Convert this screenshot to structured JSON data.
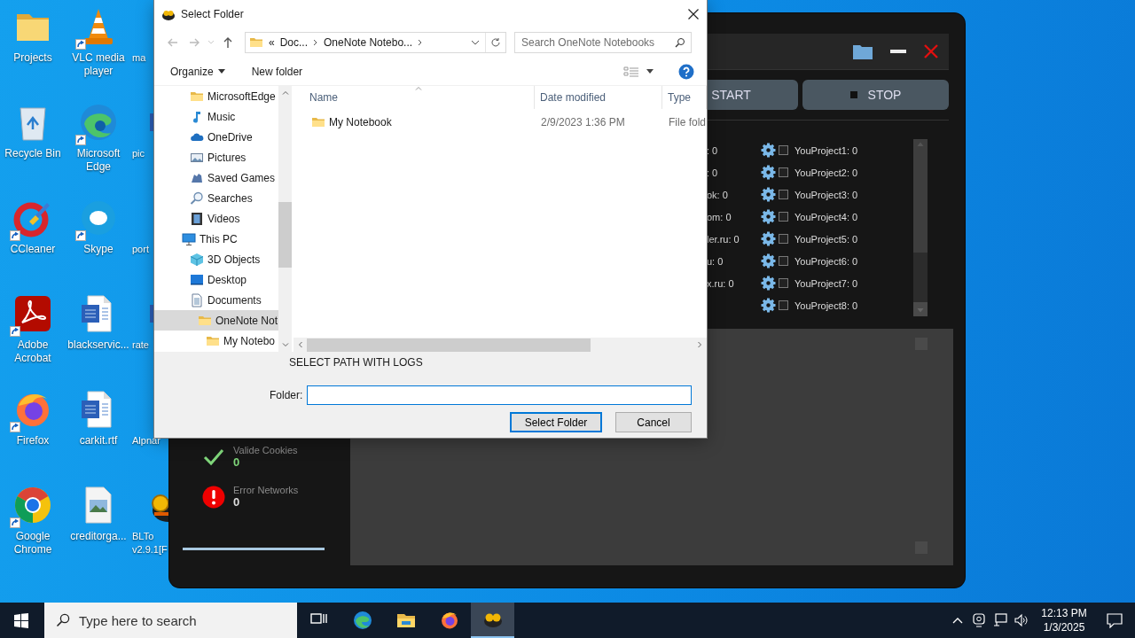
{
  "desktop": {
    "icons": [
      {
        "label": "Projects",
        "kind": "folder",
        "shortcut": false
      },
      {
        "label": "Recycle Bin",
        "kind": "recycle",
        "shortcut": false
      },
      {
        "label": "CCleaner",
        "kind": "ccleaner",
        "shortcut": true
      },
      {
        "label": "Adobe Acrobat",
        "kind": "acrobat",
        "shortcut": true
      },
      {
        "label": "Firefox",
        "kind": "firefox",
        "shortcut": true
      },
      {
        "label": "Google Chrome",
        "kind": "chrome",
        "shortcut": true
      },
      {
        "label": "VLC media player",
        "kind": "vlc",
        "shortcut": true
      },
      {
        "label": "Microsoft Edge",
        "kind": "edge",
        "shortcut": true
      },
      {
        "label": "Skype",
        "kind": "skype",
        "shortcut": true
      },
      {
        "label": "blackservic...",
        "kind": "word",
        "shortcut": false
      },
      {
        "label": "carkit.rtf",
        "kind": "word",
        "shortcut": false
      },
      {
        "label": "creditorga...",
        "kind": "image",
        "shortcut": false
      },
      {
        "label": "ma"
      },
      {
        "label": "pic",
        "kind": "word"
      },
      {
        "label": "port"
      },
      {
        "label": "rate",
        "kind": "word"
      },
      {
        "label": "Alpnar"
      },
      {
        "label": "BLTo v2.9.1[F",
        "kind": "blt"
      }
    ]
  },
  "app": {
    "controls": [
      {
        "label": "START",
        "kind": "start"
      },
      {
        "label": "STOP",
        "kind": "stop"
      }
    ],
    "counters": [
      ": 0",
      ": 0",
      "ok: 0",
      "om: 0",
      "ler.ru: 0",
      "u: 0",
      "x.ru: 0"
    ],
    "projects": [
      {
        "label": "YouProject1: 0",
        "checked": false
      },
      {
        "label": "YouProject2: 0",
        "checked": false
      },
      {
        "label": "YouProject3: 0",
        "checked": false
      },
      {
        "label": "YouProject4: 0",
        "checked": false
      },
      {
        "label": "YouProject5: 0",
        "checked": false
      },
      {
        "label": "YouProject6: 0",
        "checked": false
      },
      {
        "label": "YouProject7: 0",
        "checked": false
      },
      {
        "label": "YouProject8: 0",
        "checked": false
      }
    ],
    "stats": [
      {
        "kind": "valid",
        "label": "Valide Cookies",
        "value": "0"
      },
      {
        "kind": "error",
        "label": "Error Networks",
        "value": "0"
      }
    ]
  },
  "dialog": {
    "title": "Select Folder",
    "breadcrumb": {
      "overflow": "«",
      "parts": [
        "Doc...",
        "OneNote Notebo..."
      ]
    },
    "search_placeholder": "Search OneNote Notebooks",
    "toolbar": {
      "organize": "Organize",
      "new_folder": "New folder"
    },
    "nav": {
      "upper_items": [
        {
          "label": "MicrosoftEdge",
          "kind": "folder",
          "selected": false
        },
        {
          "label": "Music",
          "kind": "music",
          "selected": false
        },
        {
          "label": "OneDrive",
          "kind": "cloud",
          "selected": false
        },
        {
          "label": "Pictures",
          "kind": "pictures",
          "selected": false
        },
        {
          "label": "Saved Games",
          "kind": "games",
          "selected": false
        },
        {
          "label": "Searches",
          "kind": "search",
          "selected": false
        },
        {
          "label": "Videos",
          "kind": "videos",
          "selected": false
        }
      ],
      "tree": [
        {
          "label": "This PC",
          "kind": "pc",
          "selected": false,
          "children": [
            {
              "label": "3D Objects",
              "kind": "cube",
              "selected": false
            },
            {
              "label": "Desktop",
              "kind": "desktop",
              "selected": false
            },
            {
              "label": "Documents",
              "kind": "documents",
              "selected": false,
              "children": [
                {
                  "label": "OneNote Not",
                  "kind": "folder",
                  "selected": true,
                  "children": [
                    {
                      "label": "My Notebo",
                      "kind": "folder",
                      "selected": false
                    }
                  ]
                }
              ]
            }
          ]
        }
      ]
    },
    "columns": [
      "Name",
      "Date modified",
      "Type"
    ],
    "files": [
      {
        "name": "My Notebook",
        "date": "2/9/2023 1:36 PM",
        "type": "File fold"
      }
    ],
    "prompt": "SELECT PATH WITH LOGS",
    "folder_field": {
      "label": "Folder:",
      "focused": true
    },
    "buttons": [
      {
        "label": "Select Folder",
        "default": true
      },
      {
        "label": "Cancel",
        "default": false
      }
    ]
  },
  "taskbar": {
    "search_placeholder": "Type here to search",
    "apps": [
      {
        "kind": "taskview",
        "active": false
      },
      {
        "kind": "edge",
        "active": false
      },
      {
        "kind": "explorer",
        "active": false
      },
      {
        "kind": "firefox",
        "active": false
      },
      {
        "kind": "blt",
        "active": true
      }
    ],
    "time": "12:13 PM",
    "date": "1/3/2025"
  }
}
